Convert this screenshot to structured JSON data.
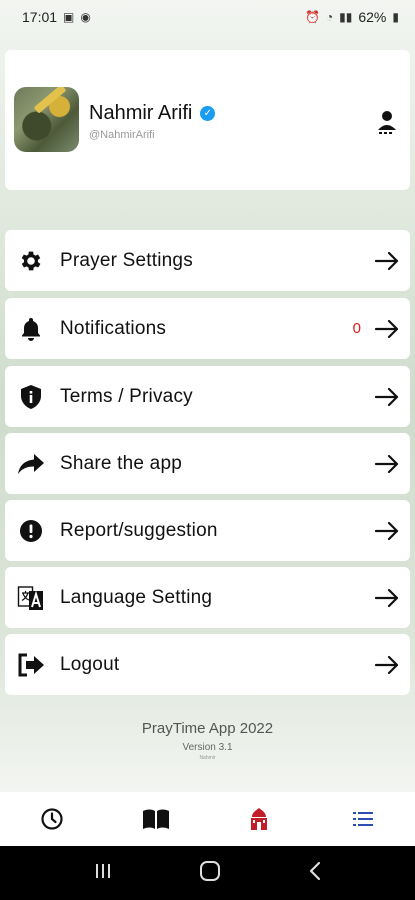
{
  "status_bar": {
    "time": "17:01",
    "battery": "62%"
  },
  "profile": {
    "name": "Nahmir Arifi",
    "handle": "@NahmirArifi"
  },
  "menu": [
    {
      "label": "Prayer Settings",
      "icon": "gear-icon"
    },
    {
      "label": "Notifications",
      "icon": "bell-icon",
      "badge": "0"
    },
    {
      "label": "Terms / Privacy",
      "icon": "shield-icon"
    },
    {
      "label": "Share the app",
      "icon": "share-icon"
    },
    {
      "label": "Report/suggestion",
      "icon": "alert-icon"
    },
    {
      "label": "Language Setting",
      "icon": "translate-icon"
    },
    {
      "label": "Logout",
      "icon": "logout-icon"
    }
  ],
  "footer": {
    "app_name": "PrayTime App 2022",
    "version": "Version 3.1",
    "credit": "Nahmir"
  },
  "colors": {
    "badge": "#e01b1b",
    "verified": "#1a9df0",
    "active_tab": "#c21e2a",
    "list_tab": "#2a4fb0"
  }
}
